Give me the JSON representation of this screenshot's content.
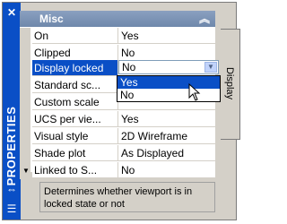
{
  "window": {
    "title": "PROPERTIES",
    "close_icon": "close-icon",
    "side_tab_label": "Display"
  },
  "category": {
    "label": "Misc",
    "collapse_icon": "chevron-double-up-icon"
  },
  "rows": [
    {
      "name": "On",
      "value": "Yes"
    },
    {
      "name": "Clipped",
      "value": "No"
    },
    {
      "name": "Display locked",
      "value": "No"
    },
    {
      "name": "Standard sc...",
      "value": ""
    },
    {
      "name": "Custom scale",
      "value": ""
    },
    {
      "name": "UCS per vie...",
      "value": "Yes"
    },
    {
      "name": "Visual style",
      "value": "2D Wireframe"
    },
    {
      "name": "Shade plot",
      "value": "As Displayed"
    },
    {
      "name": "Linked to S...",
      "value": "No"
    }
  ],
  "dropdown": {
    "selected": "No",
    "options": [
      "Yes",
      "No"
    ],
    "highlighted": "Yes"
  },
  "description": "Determines whether viewport is in locked state or not",
  "colors": {
    "titlebar": "#0a4fc6",
    "selection": "#0a4fc6",
    "panel": "#d4d0c8",
    "category_header": "#7f95b8"
  }
}
